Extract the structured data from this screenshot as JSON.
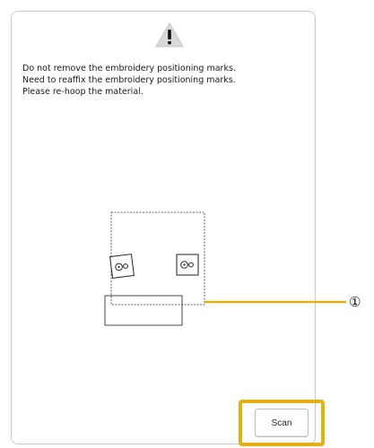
{
  "dialog": {
    "icon": "warning-triangle-icon",
    "message_lines": [
      "Do not remove the embroidery positioning marks.",
      "Need to reaffix the embroidery positioning marks.",
      "Please re-hoop the material."
    ],
    "scan_label": "Scan",
    "highlight_color": "#e1b011"
  },
  "callout": {
    "label": "①",
    "line_color": "#e1b011"
  }
}
